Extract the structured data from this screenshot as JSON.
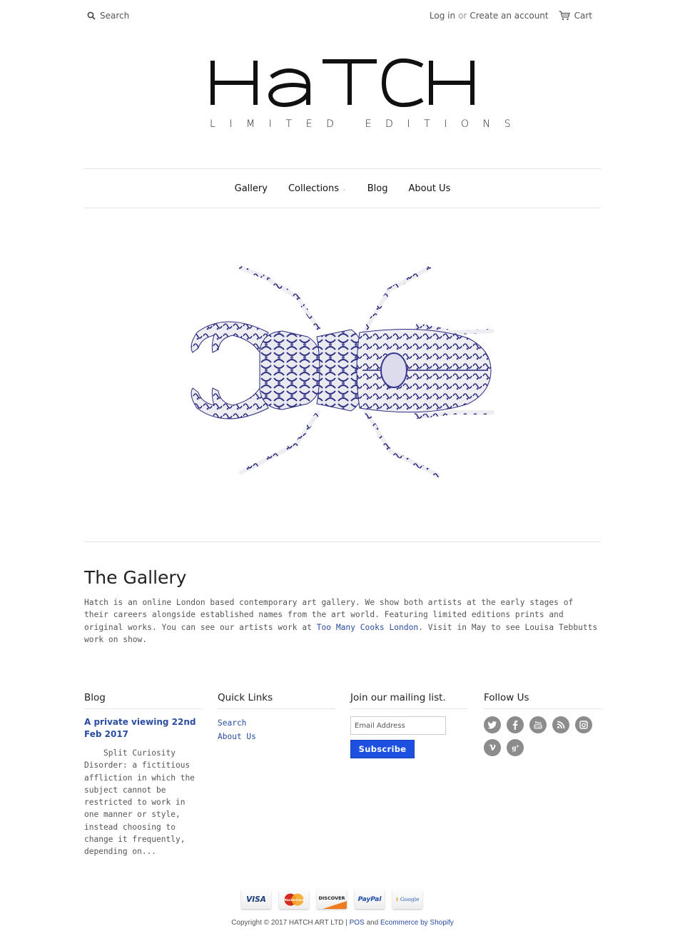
{
  "header": {
    "search_label": "Search",
    "login_label": "Log in",
    "or_label": "or",
    "create_account_label": "Create an account",
    "cart_label": "Cart"
  },
  "logo": {
    "name": "HATCH",
    "tagline": "LIMITED EDITIONS"
  },
  "nav": {
    "items": [
      {
        "label": "Gallery"
      },
      {
        "label": "Collections",
        "has_dropdown": true
      },
      {
        "label": "Blog"
      },
      {
        "label": "About Us"
      }
    ]
  },
  "hero": {
    "alt": "Porcelain-patterned stag beetle artwork",
    "accent_color": "#2a2a80"
  },
  "gallery": {
    "title": "The Gallery",
    "text_before_link": "Hatch is an online London based contemporary art gallery. We show both artists at the early stages of their careers alongside established names from the art world. Featuring limited editions prints and original works. You can see our artists work at ",
    "link_text": "Too Many Cooks London",
    "text_after_link": ". Visit in May to see Louisa Tebbutts work on show."
  },
  "footer": {
    "blog": {
      "heading": "Blog",
      "post_title": "A private viewing 22nd Feb 2017",
      "excerpt": "    Split Curiosity Disorder: a fictitious affliction in which the subject cannot be restricted to work in one manner or style, instead choosing to change it frequently, depending on..."
    },
    "quick_links": {
      "heading": "Quick Links",
      "items": [
        "Search",
        "About Us"
      ]
    },
    "mailing": {
      "heading": "Join our mailing list.",
      "email_placeholder": "Email Address",
      "subscribe_label": "Subscribe"
    },
    "follow": {
      "heading": "Follow Us",
      "icons": [
        "twitter",
        "facebook",
        "youtube",
        "rss",
        "instagram",
        "vimeo",
        "google-plus"
      ]
    },
    "payments": [
      "VISA",
      "MasterCard",
      "DISCOVER",
      "PayPal",
      "Google"
    ],
    "copyright_text": "Copyright © 2017 HATCH ART LTD | ",
    "pos_link": "POS",
    "and_text": " and ",
    "ecommerce_link": "Ecommerce by Shopify"
  },
  "colors": {
    "link": "#2b4da0",
    "subscribe_bg": "#1d4fe0",
    "social_icon": "#8c8c8c",
    "divider": "#e4e4e4"
  }
}
